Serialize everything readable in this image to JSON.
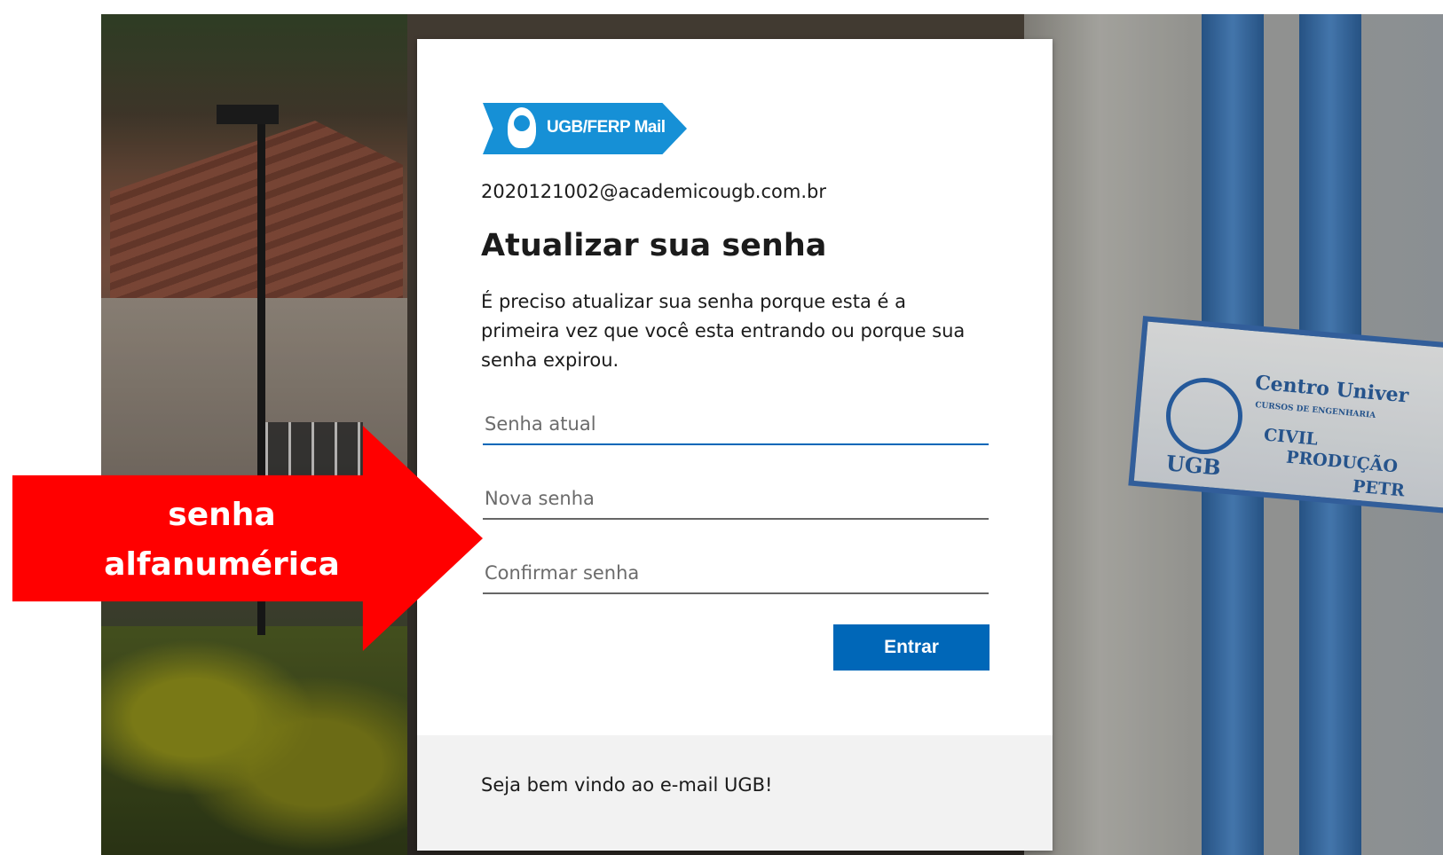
{
  "login": {
    "logo_text": "UGB/FERP Mail",
    "account": "2020121002@academicougb.com.br",
    "title": "Atualizar sua senha",
    "description": "É preciso atualizar sua senha porque esta é a primeira vez que você esta entrando ou porque sua senha expirou.",
    "fields": {
      "current_password_placeholder": "Senha atual",
      "new_password_placeholder": "Nova senha",
      "confirm_password_placeholder": "Confirmar senha"
    },
    "submit_label": "Entrar",
    "footer_text": "Seja bem vindo ao e-mail UGB!"
  },
  "annotation": {
    "line1": "senha",
    "line2": "alfanumérica"
  },
  "background_sign": {
    "line1": "Centro Univer",
    "line2": "CURSOS DE ENGENHARIA",
    "line3": "CIVIL",
    "line4": "PRODUÇÃO",
    "line5": "PETR",
    "logo_text": "UGB"
  },
  "colors": {
    "primary": "#0067b8",
    "logo_blue": "#1690d6",
    "annotation_red": "#ff0000",
    "footer_bg": "#f2f2f2"
  }
}
